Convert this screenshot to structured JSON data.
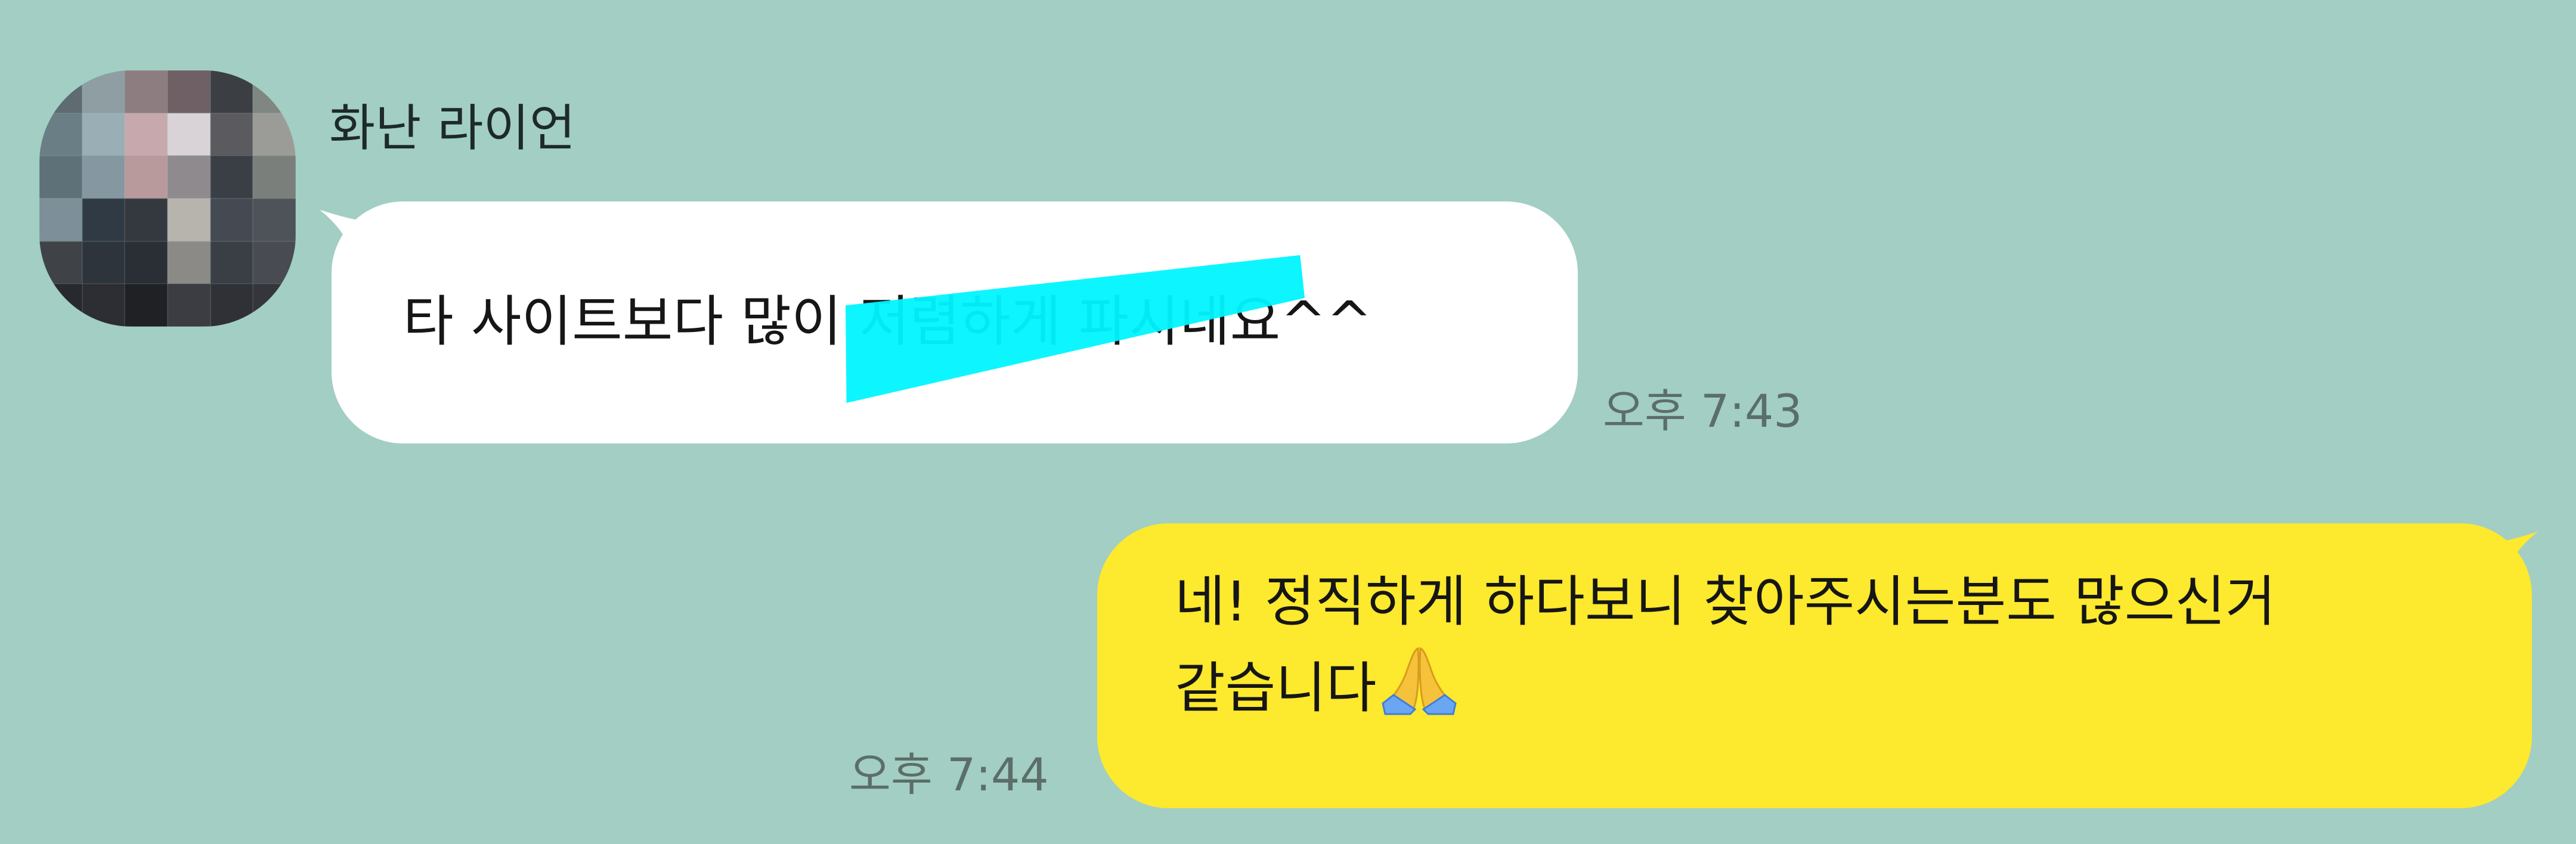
{
  "contact": {
    "name": "화난 라이언",
    "avatar_pixels": [
      "#5e6b70",
      "#8f9ea3",
      "#8e7d80",
      "#6e6064",
      "#3b3f44",
      "#808682",
      "#6a7e86",
      "#9aaeb5",
      "#c7a9ad",
      "#d9d3d8",
      "#5b5a5f",
      "#9b9c98",
      "#5f7178",
      "#8597a0",
      "#b89a9c",
      "#8f8a8e",
      "#3a3f45",
      "#7a7f7c",
      "#7d8f98",
      "#2f3a44",
      "#34393f",
      "#b7b3ad",
      "#454a52",
      "#4e535a",
      "#3f4348",
      "#2e343b",
      "#2a2f36",
      "#8b8a86",
      "#3a3e45",
      "#484c52",
      "#27292e",
      "#2c2e33",
      "#1f2125",
      "#3b3d42",
      "#2f3136",
      "#34363b"
    ]
  },
  "messages": [
    {
      "direction": "incoming",
      "text": "타 사이트보다 많이 저렴하게 파시네요^^",
      "time": "오후 7:43",
      "highlight_color": "#00f5ff"
    },
    {
      "direction": "outgoing",
      "lines": [
        "네! 정직하게 하다보니 찾아주시는분도 많으신거",
        "같습니다"
      ],
      "emoji": "folded-hands",
      "time": "오후 7:44"
    }
  ],
  "colors": {
    "background": "#a2cec3",
    "incoming_bubble": "#ffffff",
    "outgoing_bubble": "#fde92d",
    "timestamp": "#5c6e69"
  }
}
